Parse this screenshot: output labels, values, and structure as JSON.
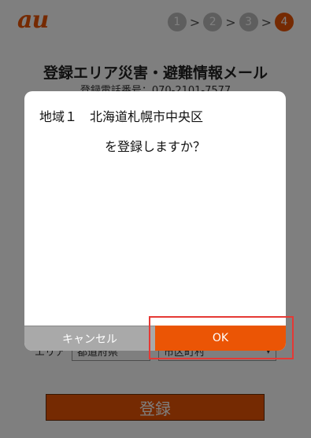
{
  "header": {
    "logo": "au",
    "steps": [
      "1",
      "2",
      "3",
      "4"
    ],
    "step_separator": ">",
    "active_step": 4
  },
  "page": {
    "title": "登録エリア災害・避難情報メール",
    "phone_label": "登録電話番号：070-2101-7577",
    "area_label": "エリア",
    "prefecture_select": "都道府県",
    "city_select": "市区町村",
    "register_button": "登録"
  },
  "dialog": {
    "line1": "地域１　北海道札幌市中央区",
    "line2": "を登録しますか？",
    "cancel_label": "キャンセル",
    "ok_label": "OK"
  },
  "colors": {
    "brand": "#eb5505",
    "overlay": "rgba(0,0,0,0.5)",
    "highlight": "#e53935"
  }
}
